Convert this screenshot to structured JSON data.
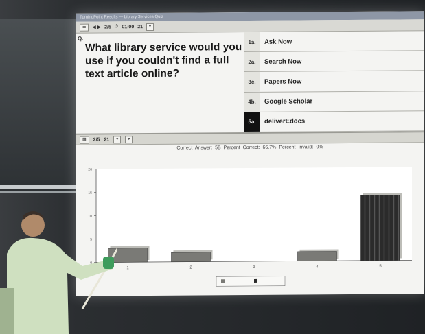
{
  "app": {
    "title": "TurningPoint Results — Library Services Quiz",
    "toolbar": {
      "slide_counter": "2/5",
      "timer": "01:00",
      "responses": "21"
    }
  },
  "question": {
    "label": "Q.",
    "text": "What library service would you use if you couldn't find a full text article online?"
  },
  "answers": [
    {
      "tag": "1a.",
      "label": "Ask Now",
      "selected": false
    },
    {
      "tag": "2a.",
      "label": "Search Now",
      "selected": false
    },
    {
      "tag": "3c.",
      "label": "Papers Now",
      "selected": false
    },
    {
      "tag": "4b.",
      "label": "Google Scholar",
      "selected": false
    },
    {
      "tag": "5a.",
      "label": "deliverEdocs",
      "selected": true
    }
  ],
  "results_toolbar": {
    "slide_counter": "2/5",
    "responses": "21"
  },
  "stats": {
    "correct_answer": "Correct Answer: 5B",
    "percent_correct": "Percent Correct: 66.7%",
    "percent_invalid": "Percent Invalid: 0%"
  },
  "chart_data": {
    "type": "bar",
    "categories": [
      "1",
      "2",
      "3",
      "4",
      "5"
    ],
    "values": [
      3,
      2,
      0,
      2,
      14
    ],
    "ylim": [
      0,
      20
    ],
    "highlight_index": 4,
    "colors": {
      "bar": "#7a7a76",
      "highlight": "#2b2b2b",
      "axis": "#555555"
    }
  }
}
